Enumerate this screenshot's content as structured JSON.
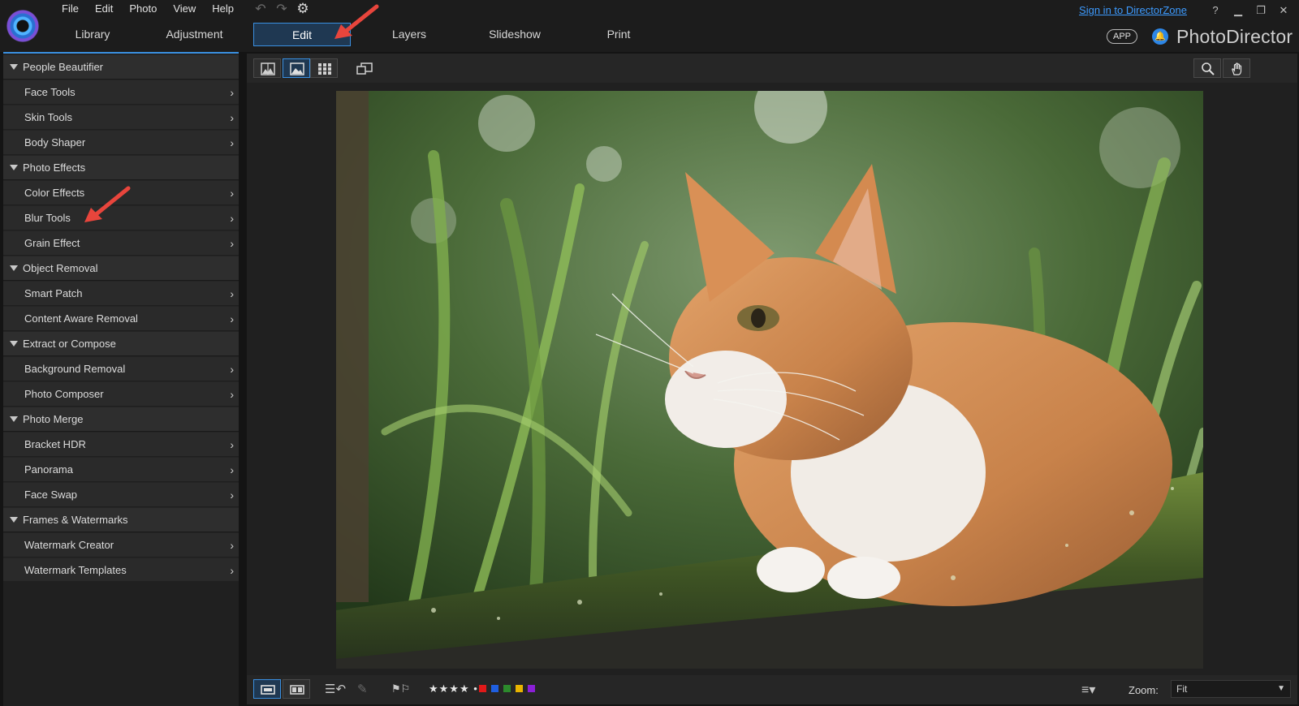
{
  "menus": [
    "File",
    "Edit",
    "Photo",
    "View",
    "Help"
  ],
  "tabs": [
    {
      "label": "Library"
    },
    {
      "label": "Adjustment"
    },
    {
      "label": "Edit",
      "active": true
    },
    {
      "label": "Layers"
    },
    {
      "label": "Slideshow"
    },
    {
      "label": "Print"
    }
  ],
  "header": {
    "signin": "Sign in to DirectorZone",
    "help": "?",
    "app_badge": "APP",
    "brand": "PhotoDirector"
  },
  "panel": {
    "sections": [
      {
        "title": "People Beautifier",
        "items": [
          "Face Tools",
          "Skin Tools",
          "Body Shaper"
        ]
      },
      {
        "title": "Photo Effects",
        "items": [
          "Color Effects",
          "Blur Tools",
          "Grain Effect"
        ]
      },
      {
        "title": "Object Removal",
        "items": [
          "Smart Patch",
          "Content Aware Removal"
        ]
      },
      {
        "title": "Extract or Compose",
        "items": [
          "Background Removal",
          "Photo Composer"
        ]
      },
      {
        "title": "Photo Merge",
        "items": [
          "Bracket HDR",
          "Panorama",
          "Face Swap"
        ]
      },
      {
        "title": "Frames & Watermarks",
        "items": [
          "Watermark Creator",
          "Watermark Templates"
        ]
      }
    ]
  },
  "bottom": {
    "rating": "★★★★",
    "color_labels": [
      "#e01919",
      "#1f5fe0",
      "#2c8a2c",
      "#e8b400",
      "#8b1fd6"
    ],
    "zoom_label": "Zoom:",
    "zoom_value": "Fit"
  },
  "colors": {
    "accent": "#3a8fe0",
    "annotation": "#e8453c"
  }
}
